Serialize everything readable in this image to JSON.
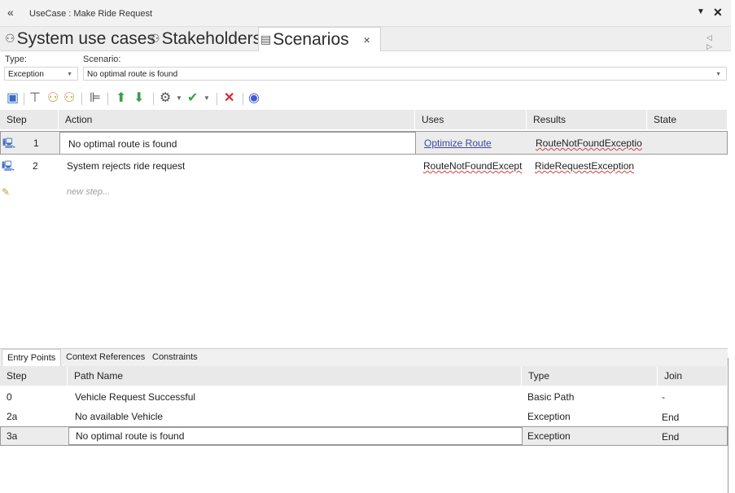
{
  "window": {
    "back_glyph": "«",
    "title": "UseCase : Make Ride Request",
    "menu_glyph": "▼",
    "close_glyph": "✕"
  },
  "tabs": [
    {
      "label": "System use cases",
      "icon": "usecase-icon",
      "glyph": "⚇"
    },
    {
      "label": "Stakeholders",
      "icon": "usecase-icon",
      "glyph": "⚇"
    },
    {
      "label": "Scenarios",
      "icon": "scenario-icon",
      "glyph": "▤",
      "close": "×"
    }
  ],
  "tab_scroll": "◁ ▷",
  "type_label": "Type:",
  "scenario_label": "Scenario:",
  "type_value": "Exception",
  "scenario_value": "No optimal route is found",
  "toolbar_icons": [
    "save-icon",
    "insert-step-icon",
    "add-actor-icon",
    "remove-actor-icon",
    "tree-icon",
    "move-up-icon",
    "move-down-icon",
    "generate-icon",
    "validate-icon",
    "delete-icon",
    "help-icon"
  ],
  "steps": {
    "columns": [
      "Step",
      "Action",
      "Uses",
      "Results",
      "State"
    ],
    "rows": [
      {
        "step": "1",
        "action": "No optimal route is found",
        "uses": "Optimize Route",
        "results": "RouteNotFoundExceptio",
        "state": ""
      },
      {
        "step": "2",
        "action": "System rejects ride request",
        "uses": "RouteNotFoundExcept",
        "results": "RideRequestException",
        "state": ""
      }
    ],
    "new_step_placeholder": "new step..."
  },
  "bottom_tabs": [
    "Entry Points",
    "Context References",
    "Constraints"
  ],
  "entry_points": {
    "columns": [
      "Step",
      "Path Name",
      "Type",
      "Join"
    ],
    "rows": [
      {
        "step": "0",
        "path": "Vehicle Request Successful",
        "type": "Basic Path",
        "join": "-"
      },
      {
        "step": "2a",
        "path": "No available Vehicle",
        "type": "Exception",
        "join": "End"
      },
      {
        "step": "3a",
        "path": "No optimal route is found",
        "type": "Exception",
        "join": "End"
      }
    ]
  },
  "colors": {
    "accent_link": "#3d4aa0",
    "delete_red": "#d9272e",
    "arrow_green": "#3aa14a",
    "help_blue": "#3d5bd9"
  }
}
